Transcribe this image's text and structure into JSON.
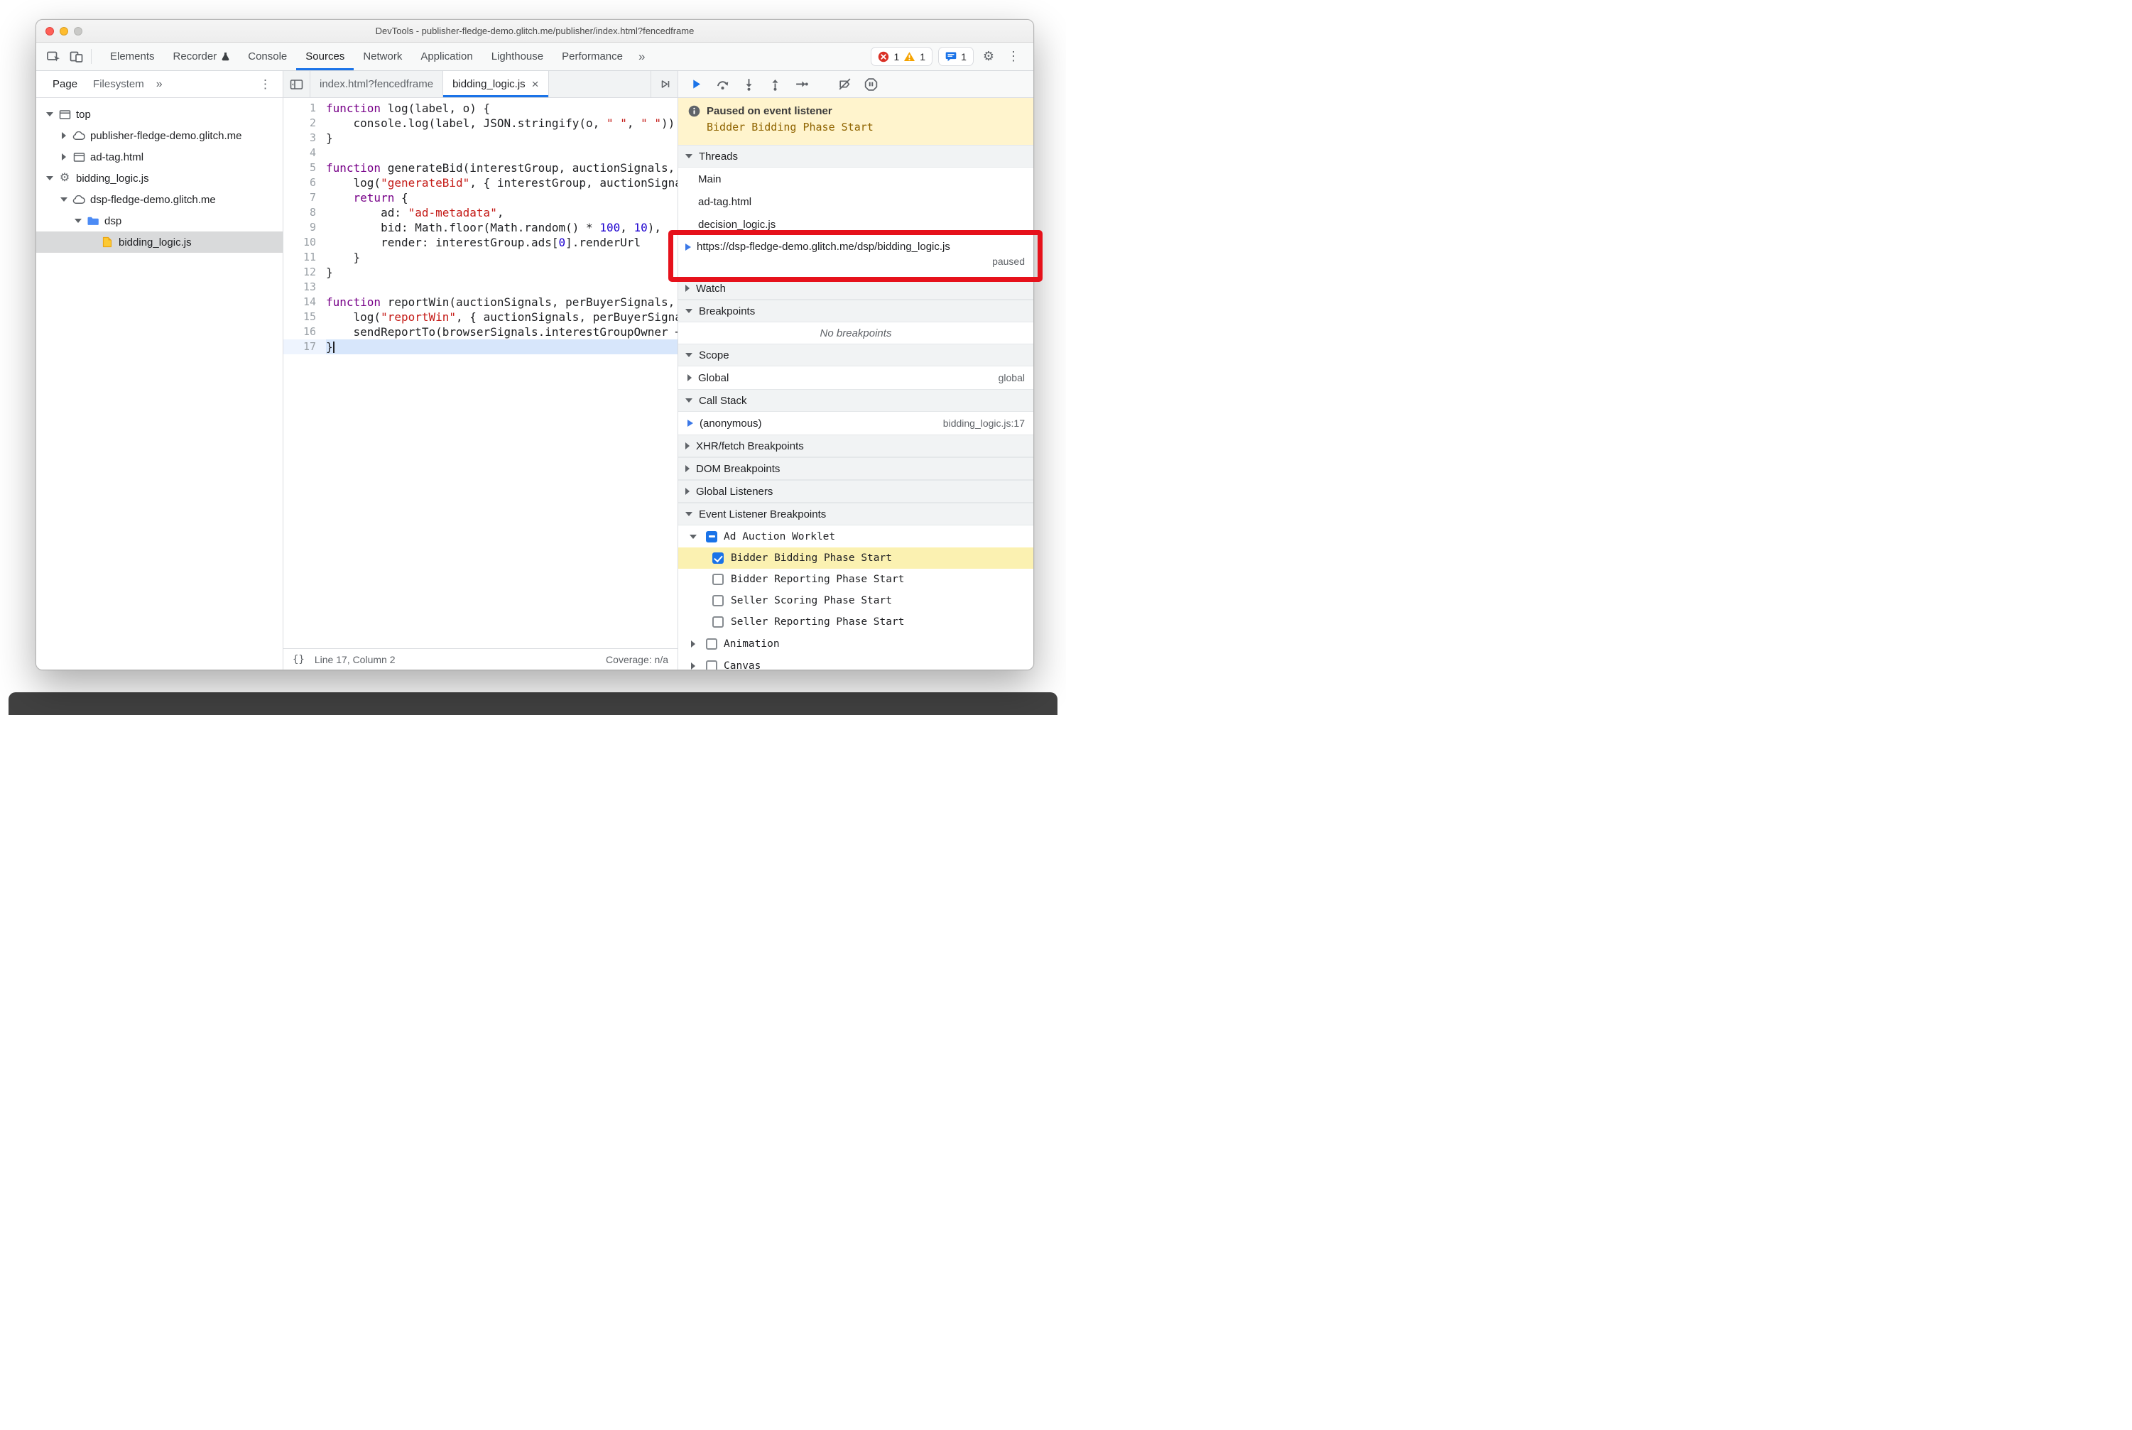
{
  "window": {
    "title": "DevTools - publisher-fledge-demo.glitch.me/publisher/index.html?fencedframe"
  },
  "colors": {
    "accent_blue": "#1a73e8",
    "error_red": "#d93025",
    "warning_yellow": "#f5a300",
    "paused_banner_bg": "#fff4cd",
    "breakpoint_hit_row_bg": "#fbf1b1",
    "annotation_red": "#e6111b",
    "folder_blue": "#4c8bf5",
    "js_file_yellow": "#fcc934",
    "selected_row_gray": "#d9dadb",
    "current_line_blue": "#d7e6fb"
  },
  "toolbar": {
    "tabs": [
      {
        "label": "Elements",
        "active": false
      },
      {
        "label": "Recorder",
        "active": false,
        "icon": "flask"
      },
      {
        "label": "Console",
        "active": false
      },
      {
        "label": "Sources",
        "active": true
      },
      {
        "label": "Network",
        "active": false
      },
      {
        "label": "Application",
        "active": false
      },
      {
        "label": "Lighthouse",
        "active": false
      },
      {
        "label": "Performance",
        "active": false
      }
    ],
    "overflow_chevron": "»",
    "error_count": "1",
    "warning_count": "1",
    "message_count": "1",
    "settings_icon": "⚙",
    "menu_icon": "⋮"
  },
  "navigator": {
    "tabs": [
      {
        "label": "Page",
        "active": true
      },
      {
        "label": "Filesystem",
        "active": false
      }
    ],
    "overflow_chevron": "»",
    "menu_icon": "⋮",
    "tree": [
      {
        "label": "top",
        "icon": "frame",
        "arrow": "expanded",
        "depth": 0
      },
      {
        "label": "publisher-fledge-demo.glitch.me",
        "icon": "cloud",
        "arrow": "collapsed",
        "depth": 1
      },
      {
        "label": "ad-tag.html",
        "icon": "frame",
        "arrow": "collapsed",
        "depth": 1
      },
      {
        "label": "bidding_logic.js",
        "icon": "gear",
        "arrow": "expanded",
        "depth": 0
      },
      {
        "label": "dsp-fledge-demo.glitch.me",
        "icon": "cloud",
        "arrow": "expanded",
        "depth": 1
      },
      {
        "label": "dsp",
        "icon": "folder",
        "arrow": "expanded",
        "depth": 2
      },
      {
        "label": "bidding_logic.js",
        "icon": "js-file",
        "arrow": "none",
        "depth": 3,
        "selected": true
      }
    ]
  },
  "editor": {
    "tabs": [
      {
        "label": "index.html?fencedframe",
        "active": false,
        "closable": false
      },
      {
        "label": "bidding_logic.js",
        "active": true,
        "closable": true
      }
    ],
    "close_icon": "×",
    "lines": [
      {
        "n": "1",
        "tokens": [
          [
            "kw",
            "function"
          ],
          [
            "pl",
            " log(label, o) {"
          ]
        ]
      },
      {
        "n": "2",
        "tokens": [
          [
            "pl",
            "    console.log(label, JSON.stringify(o, "
          ],
          [
            "str",
            "\" \""
          ],
          [
            "pl",
            ", "
          ],
          [
            "str",
            "\" \""
          ],
          [
            "pl",
            "))"
          ]
        ]
      },
      {
        "n": "3",
        "tokens": [
          [
            "pl",
            "}"
          ]
        ]
      },
      {
        "n": "4",
        "tokens": []
      },
      {
        "n": "5",
        "tokens": [
          [
            "kw",
            "function"
          ],
          [
            "pl",
            " generateBid(interestGroup, auctionSignals, perBuyerSig"
          ]
        ]
      },
      {
        "n": "6",
        "tokens": [
          [
            "pl",
            "    log("
          ],
          [
            "str",
            "\"generateBid\""
          ],
          [
            "pl",
            ", { interestGroup, auctionSignals, perBuye"
          ]
        ]
      },
      {
        "n": "7",
        "tokens": [
          [
            "pl",
            "    "
          ],
          [
            "kw",
            "return"
          ],
          [
            "pl",
            " {"
          ]
        ]
      },
      {
        "n": "8",
        "tokens": [
          [
            "pl",
            "        ad: "
          ],
          [
            "str",
            "\"ad-metadata\""
          ],
          [
            "pl",
            ","
          ]
        ]
      },
      {
        "n": "9",
        "tokens": [
          [
            "pl",
            "        bid: Math.floor(Math.random() * "
          ],
          [
            "num",
            "100"
          ],
          [
            "pl",
            ", "
          ],
          [
            "num",
            "10"
          ],
          [
            "pl",
            "),"
          ]
        ]
      },
      {
        "n": "10",
        "tokens": [
          [
            "pl",
            "        render: interestGroup.ads["
          ],
          [
            "num",
            "0"
          ],
          [
            "pl",
            "].renderUrl"
          ]
        ]
      },
      {
        "n": "11",
        "tokens": [
          [
            "pl",
            "    }"
          ]
        ]
      },
      {
        "n": "12",
        "tokens": [
          [
            "pl",
            "}"
          ]
        ]
      },
      {
        "n": "13",
        "tokens": []
      },
      {
        "n": "14",
        "tokens": [
          [
            "kw",
            "function"
          ],
          [
            "pl",
            " reportWin(auctionSignals, perBuyerSignals, sellerSign"
          ]
        ]
      },
      {
        "n": "15",
        "tokens": [
          [
            "pl",
            "    log("
          ],
          [
            "str",
            "\"reportWin\""
          ],
          [
            "pl",
            ", { auctionSignals, perBuyerSignals, sellerS"
          ]
        ]
      },
      {
        "n": "16",
        "tokens": [
          [
            "pl",
            "    sendReportTo(browserSignals.interestGroupOwner + browserSig"
          ]
        ]
      },
      {
        "n": "17",
        "tokens": [
          [
            "pl",
            "}"
          ]
        ],
        "current": true
      }
    ],
    "status": {
      "pretty_print": "{}",
      "position": "Line 17, Column 2",
      "coverage": "Coverage: n/a"
    }
  },
  "debugger": {
    "toolbar_icons": [
      "resume",
      "step-over",
      "step-into",
      "step-out",
      "step",
      "deactivate-breakpoints",
      "pause-on-exceptions"
    ],
    "paused_banner": {
      "title": "Paused on event listener",
      "detail": "Bidder Bidding Phase Start"
    },
    "sections": {
      "threads": {
        "title": "Threads",
        "items": [
          "Main",
          "ad-tag.html",
          "decision_logic.js"
        ],
        "active_thread": {
          "url": "https://dsp-fledge-demo.glitch.me/dsp/bidding_logic.js",
          "status": "paused"
        }
      },
      "watch": {
        "title": "Watch"
      },
      "breakpoints": {
        "title": "Breakpoints",
        "empty_message": "No breakpoints"
      },
      "scope": {
        "title": "Scope",
        "entries": [
          {
            "name": "Global",
            "hint": "global"
          }
        ]
      },
      "call_stack": {
        "title": "Call Stack",
        "frames": [
          {
            "name": "(anonymous)",
            "location": "bidding_logic.js:17"
          }
        ]
      },
      "xhr_breakpoints": {
        "title": "XHR/fetch Breakpoints"
      },
      "dom_breakpoints": {
        "title": "DOM Breakpoints"
      },
      "global_listeners": {
        "title": "Global Listeners"
      },
      "event_listener_breakpoints": {
        "title": "Event Listener Breakpoints",
        "categories": [
          {
            "label": "Ad Auction Worklet",
            "checkbox": "indeterminate",
            "expanded": true,
            "items": [
              {
                "label": "Bidder Bidding Phase Start",
                "checked": true,
                "highlighted": true
              },
              {
                "label": "Bidder Reporting Phase Start",
                "checked": false
              },
              {
                "label": "Seller Scoring Phase Start",
                "checked": false
              },
              {
                "label": "Seller Reporting Phase Start",
                "checked": false
              }
            ]
          },
          {
            "label": "Animation",
            "checkbox": "unchecked",
            "expanded": false,
            "items": []
          },
          {
            "label": "Canvas",
            "checkbox": "unchecked",
            "expanded": false,
            "items": []
          }
        ]
      }
    }
  },
  "annotation": {
    "type": "red-rectangle-highlight"
  }
}
